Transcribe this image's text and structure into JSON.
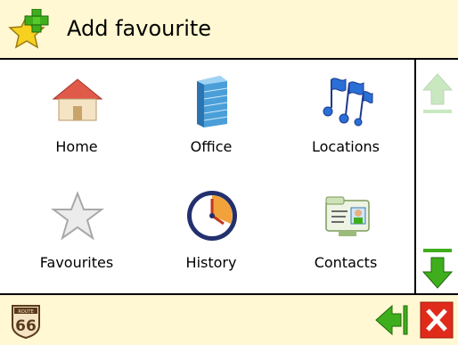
{
  "header": {
    "title": "Add favourite"
  },
  "tiles": [
    {
      "label": "Home",
      "icon": "house-icon"
    },
    {
      "label": "Office",
      "icon": "office-building-icon"
    },
    {
      "label": "Locations",
      "icon": "location-flags-icon"
    },
    {
      "label": "Favourites",
      "icon": "star-icon"
    },
    {
      "label": "History",
      "icon": "clock-icon"
    },
    {
      "label": "Contacts",
      "icon": "contact-card-icon"
    }
  ],
  "scrollbar": {
    "up_enabled": false,
    "down_enabled": true
  },
  "footer": {
    "logo_text": "66",
    "logo_small_text": "ROUTE"
  },
  "colors": {
    "header_bg": "#fff8d2",
    "accent_green": "#3fae1c",
    "close_red": "#e02b1a"
  }
}
